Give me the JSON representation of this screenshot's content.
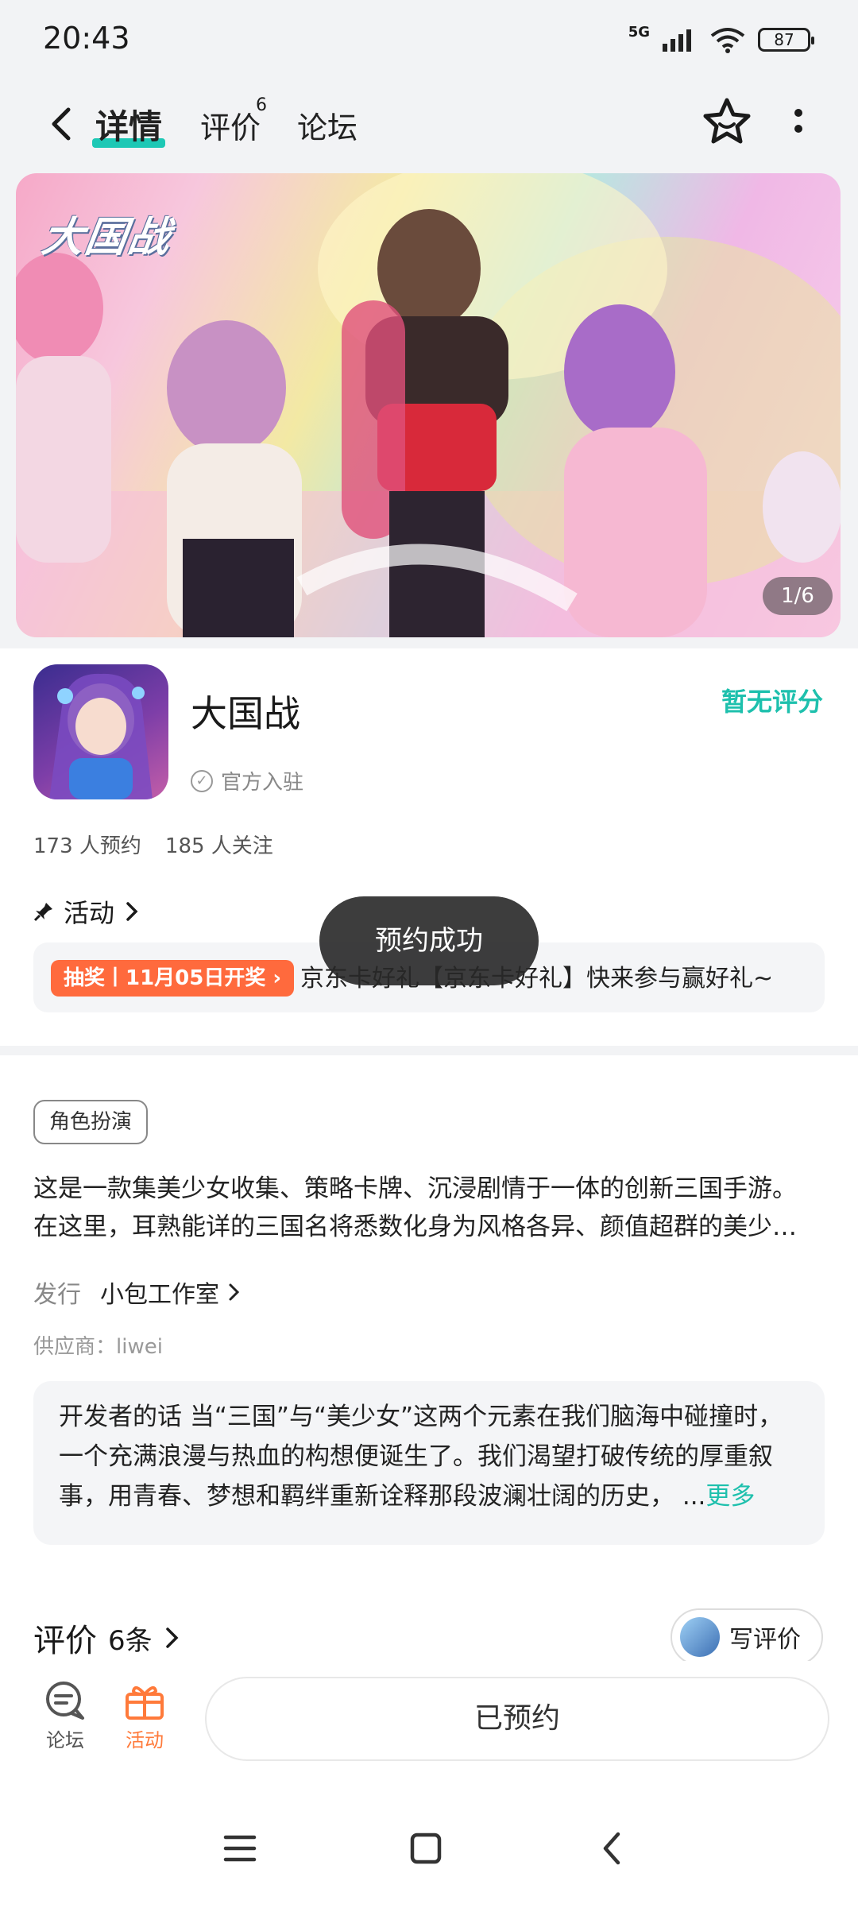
{
  "status_bar": {
    "time": "20:43",
    "network": "5G",
    "battery": "87"
  },
  "header": {
    "tabs": [
      {
        "label": "详情",
        "badge": ""
      },
      {
        "label": "评价",
        "badge": "6"
      },
      {
        "label": "论坛",
        "badge": ""
      }
    ]
  },
  "banner": {
    "logo_text": "大国战",
    "pager": "1/6"
  },
  "game": {
    "name": "大国战",
    "official_label": "官方入驻",
    "rating_text": "暂无评分",
    "reservations": "173 人预约",
    "followers": "185 人关注"
  },
  "activity": {
    "heading": "活动",
    "tag": "抽奖丨11月05日开奖",
    "text": "京东卡好礼【京东卡好礼】快来参与赢好礼~"
  },
  "toast": "预约成功",
  "details": {
    "genre": "角色扮演",
    "description_lines": [
      "这是一款集美少女收集、策略卡牌、沉浸剧情于一体的创新三国手游。",
      "在这里，耳熟能详的三国名将悉数化身为风格各异、颜值超群的美少…"
    ],
    "publisher_label": "发行",
    "publisher": "小包工作室",
    "supplier": "供应商：liwei"
  },
  "developer_note": {
    "lines": [
      "开发者的话  当“三国”与“美少女”这两个元素在我们脑海中碰撞时，",
      "一个充满浪漫与热血的构想便诞生了。我们渴望打破传统的厚重叙",
      "事，用青春、梦想和羁绊重新诠释那段波澜壮阔的历史，  ..."
    ],
    "more": "更多"
  },
  "reviews": {
    "title": "评价",
    "count": "6条",
    "write_button": "写评价"
  },
  "bottom_bar": {
    "forum": "论坛",
    "activity": "活动",
    "reserved": "已预约"
  },
  "colors": {
    "accent": "#1ec0ad",
    "orange": "#ff6a3d",
    "background": "#f2f3f5"
  }
}
